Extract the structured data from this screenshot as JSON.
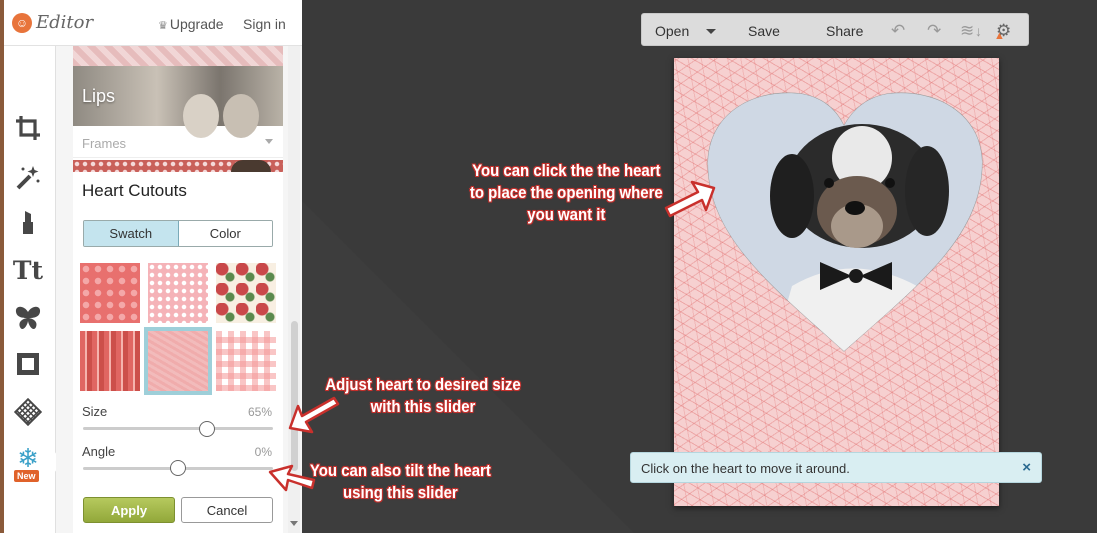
{
  "app": {
    "logo_text": "Editor",
    "upgrade_label": "Upgrade",
    "signin_label": "Sign in"
  },
  "rail": {
    "items": [
      {
        "icon": "crop-icon"
      },
      {
        "icon": "magic-wand-icon"
      },
      {
        "icon": "lipstick-icon"
      },
      {
        "icon": "text-icon",
        "glyph": "Tt"
      },
      {
        "icon": "butterfly-icon"
      },
      {
        "icon": "frame-icon"
      },
      {
        "icon": "texture-icon"
      },
      {
        "icon": "seasonal-snowflake-icon",
        "badge": "New"
      }
    ]
  },
  "panel": {
    "lips_label": "Lips",
    "frames_label": "Frames",
    "section_title": "Heart Cutouts",
    "tabs": {
      "swatch": "Swatch",
      "color": "Color",
      "active": "Swatch"
    },
    "swatches": [
      "red-hearts",
      "pink-dots",
      "roses",
      "red-stripes",
      "pink-crosshatch",
      "pink-gingham"
    ],
    "selected_swatch": "pink-crosshatch",
    "size": {
      "label": "Size",
      "value": "65%",
      "fraction": 0.65
    },
    "angle": {
      "label": "Angle",
      "value": "0%",
      "fraction": 0.5
    },
    "apply_label": "Apply",
    "cancel_label": "Cancel"
  },
  "toolbar": {
    "open": "Open",
    "save": "Save",
    "share": "Share"
  },
  "notice": {
    "text": "Click on the heart to move it around.",
    "close": "×"
  },
  "annotations": {
    "heart": "You can click the the heart to place the opening where you want it",
    "size": "Adjust heart to desired size with this slider",
    "angle": "You can also tilt the heart using this slider"
  },
  "colors": {
    "accent_green": "#9cb247",
    "tab_active": "#c4e4ee",
    "badge": "#e0622a",
    "annotation_red": "#c9302c"
  }
}
